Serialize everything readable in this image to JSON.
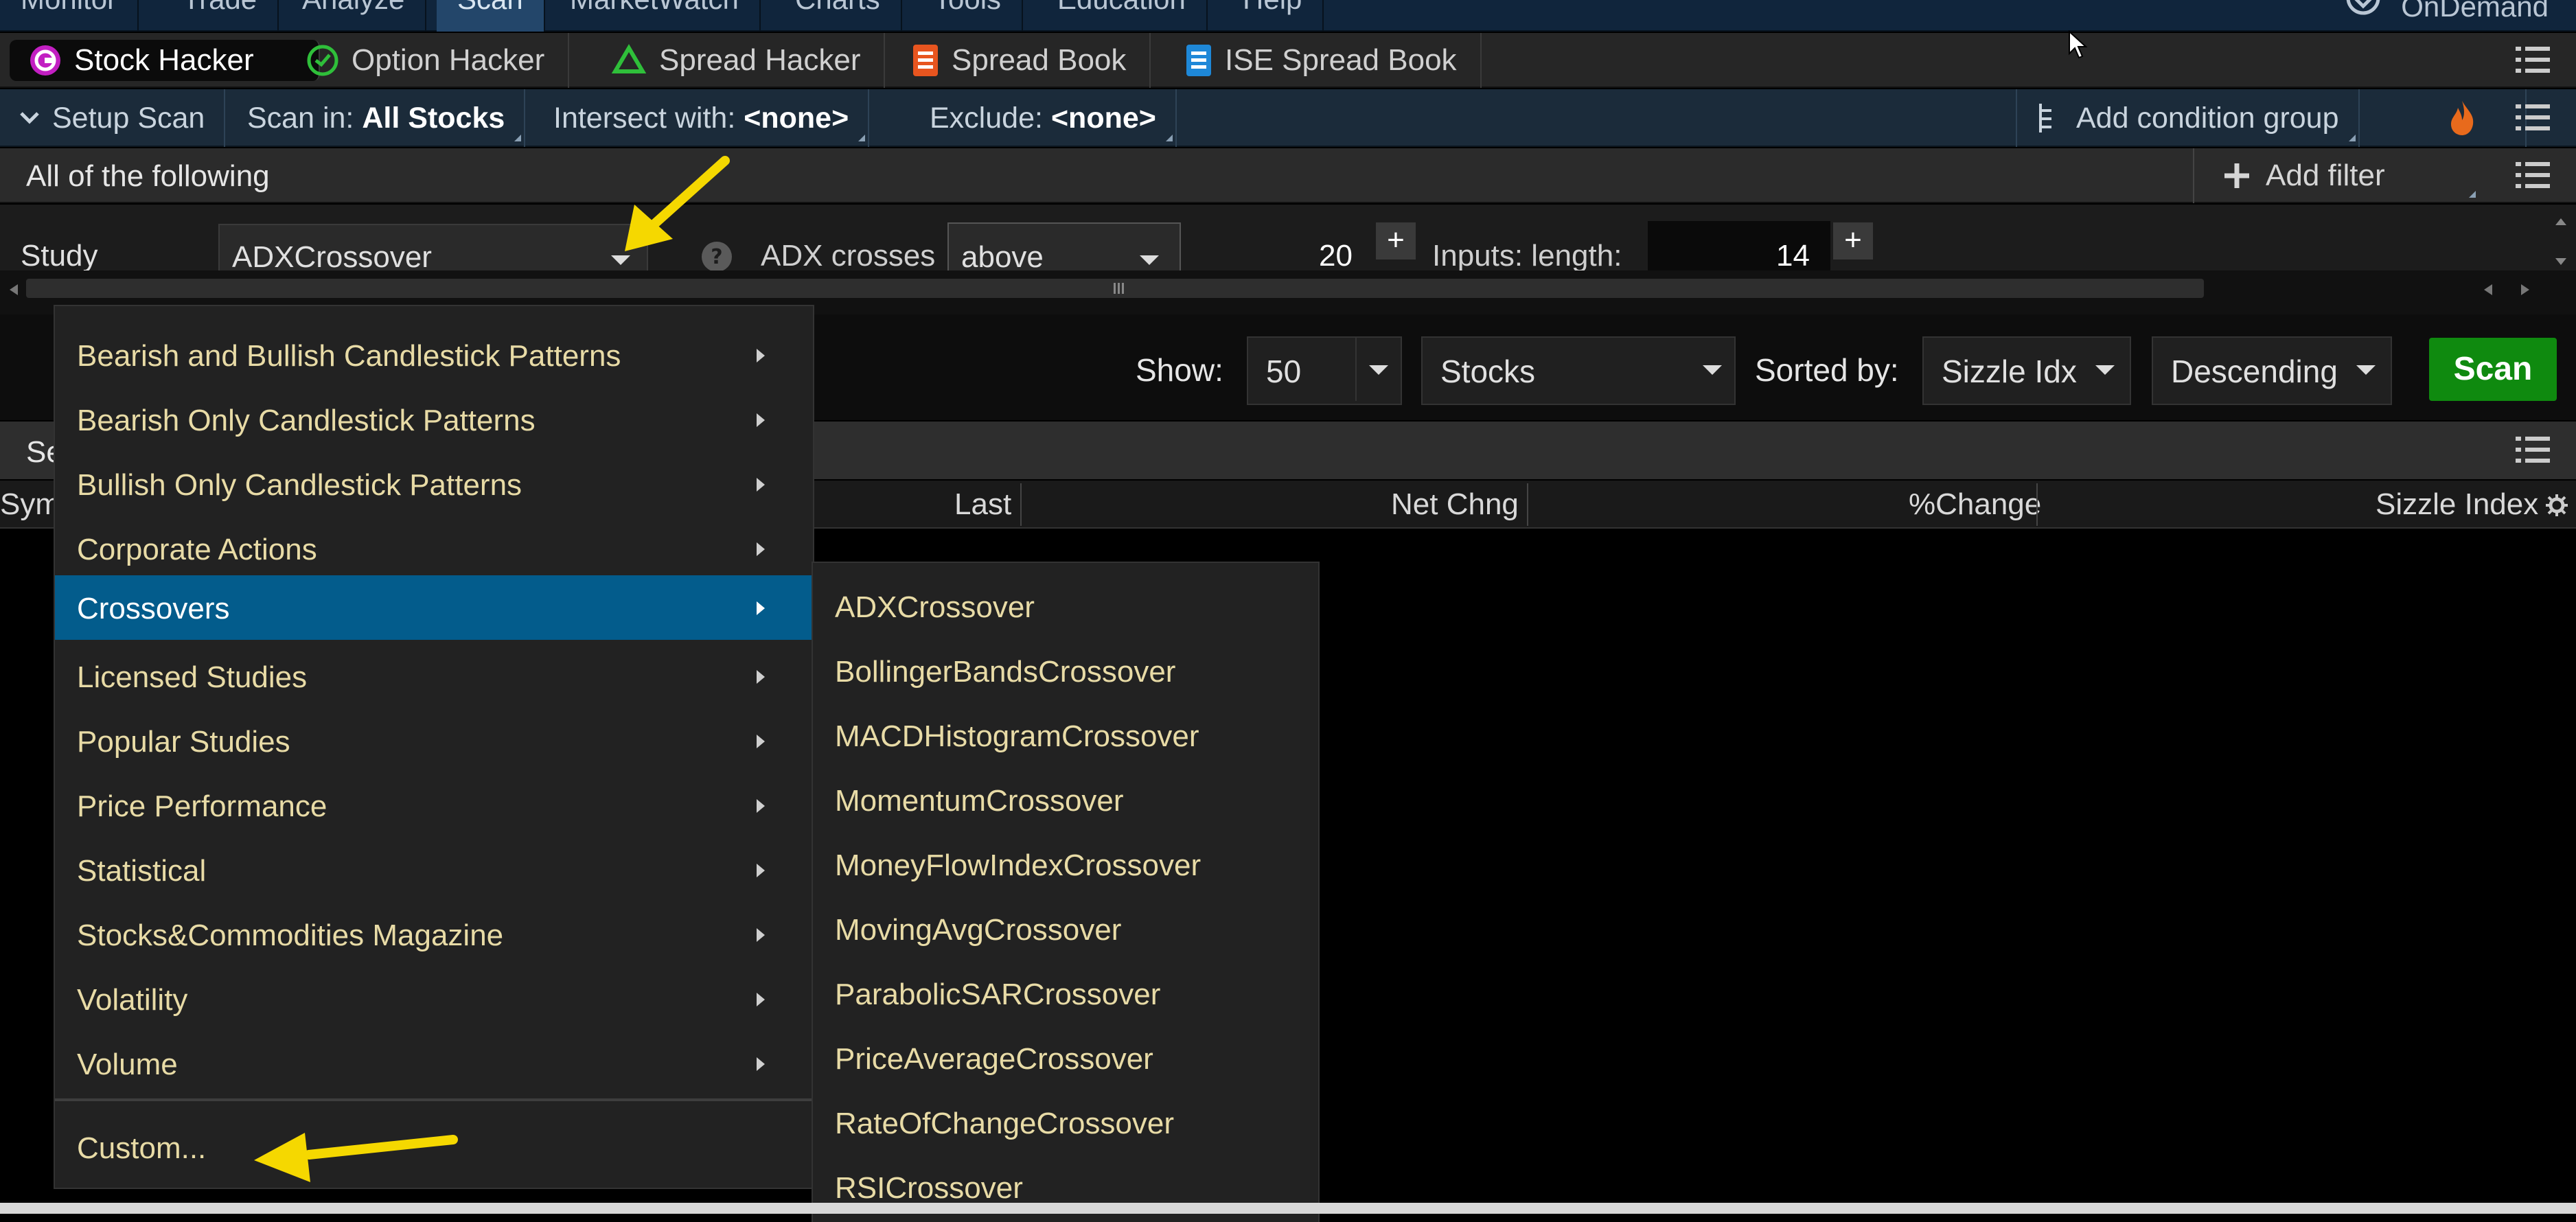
{
  "main_menu": {
    "items": [
      "Monitor",
      "Trade",
      "Analyze",
      "Scan",
      "MarketWatch",
      "Charts",
      "Tools",
      "Education",
      "Help"
    ],
    "active": "Scan",
    "ondemand": "OnDemand"
  },
  "hacker_tabs": [
    "Stock Hacker",
    "Option Hacker",
    "Spread Hacker",
    "Spread Book",
    "ISE Spread Book"
  ],
  "setup_bar": {
    "setup_scan": "Setup Scan",
    "scan_in_label": "Scan in:",
    "scan_in_value": "All Stocks",
    "intersect_label": "Intersect with:",
    "intersect_value": "<none>",
    "exclude_label": "Exclude:",
    "exclude_value": "<none>",
    "add_condition_group": "Add condition group"
  },
  "filter_bar": {
    "all_of_following": "All of the following",
    "add_filter": "Add filter"
  },
  "study_row": {
    "label": "Study",
    "study_value": "ADXCrossover",
    "adx_crosses_label": "ADX crosses",
    "direction_value": "above",
    "threshold_value": "20",
    "inputs_label": "Inputs: length:",
    "length_value": "14"
  },
  "show_row": {
    "show_label": "Show:",
    "show_value": "50",
    "type_value": "Stocks",
    "sorted_by_label": "Sorted by:",
    "sort_field_value": "Sizzle Idx",
    "sort_order_value": "Descending",
    "scan_button": "Scan"
  },
  "results": {
    "title_partial": "Se",
    "columns": [
      "Sym",
      "Last",
      "Net Chng",
      "%Change",
      "Sizzle Index"
    ]
  },
  "study_menu": {
    "items": [
      "Bearish and Bullish Candlestick Patterns",
      "Bearish Only Candlestick Patterns",
      "Bullish Only Candlestick Patterns",
      "Corporate Actions",
      "Crossovers",
      "Licensed Studies",
      "Popular Studies",
      "Price Performance",
      "Statistical",
      "Stocks&Commodities Magazine",
      "Volatility",
      "Volume"
    ],
    "selected": "Crossovers",
    "custom": "Custom..."
  },
  "crossovers_submenu": [
    "ADXCrossover",
    "BollingerBandsCrossover",
    "MACDHistogramCrossover",
    "MomentumCrossover",
    "MoneyFlowIndexCrossover",
    "MovingAvgCrossover",
    "ParabolicSARCrossover",
    "PriceAverageCrossover",
    "RateOfChangeCrossover",
    "RSICrossover"
  ],
  "colors": {
    "menu_highlight": "#035c8c",
    "menu_text": "#e8dba6",
    "scan_button": "#0f8a0f",
    "annotation_arrow": "#f5d800"
  }
}
